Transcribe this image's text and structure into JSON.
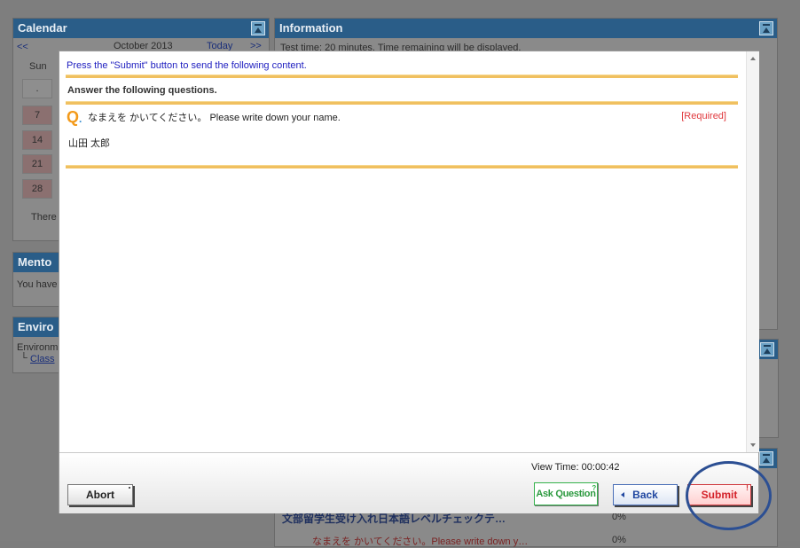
{
  "background": {
    "calendar": {
      "title": "Calendar",
      "prev_link": "<<",
      "month": "October 2013",
      "today_link": "Today",
      "next_link": ">>",
      "weekday": "Sun",
      "days": [
        ".",
        "7",
        "14",
        "21",
        "28"
      ],
      "footer_text": "There"
    },
    "information": {
      "title": "Information",
      "text": "Test time: 20 minutes. Time remaining will be displayed."
    },
    "mentor": {
      "title": "Mento",
      "text": "You have"
    },
    "environment": {
      "title": "Enviro",
      "line1": "Environm",
      "link": "Class"
    },
    "task": {
      "title": "文部留学生受け入れ日本語レベルチェックテ…",
      "percent": "0%",
      "item_text": "なまえを かいてください。Please write down y…",
      "item_percent": "0%"
    }
  },
  "dialog": {
    "notice": "Press the \"Submit\" button to send the following content.",
    "section_title": "Answer the following questions.",
    "questions": [
      {
        "mark": "Q",
        "text": "なまえを かいてください。 Please write down your name.",
        "required": "[Required]",
        "answer": "山田  太郎"
      }
    ],
    "view_time_label": "View Time: 00:00:42",
    "buttons": {
      "abort": "Abort",
      "ask": "Ask Question",
      "back": "Back",
      "submit": "Submit"
    }
  },
  "colors": {
    "panel_header": "#2a5d88",
    "notice_text": "#2020c0",
    "rule": "#f0c060",
    "required": "#e0393e",
    "submit": "#d4222a",
    "back": "#1f46a0",
    "ask": "#2d9a40",
    "highlight_circle": "#2c4f93"
  }
}
